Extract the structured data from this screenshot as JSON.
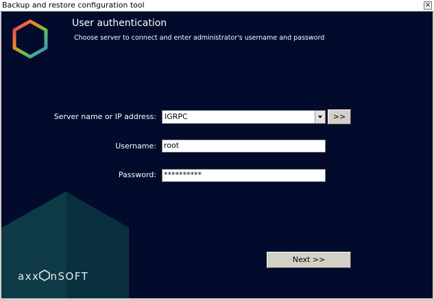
{
  "window": {
    "title": "Backup and restore configuration tool",
    "close_glyph": "×"
  },
  "header": {
    "title": "User authentication",
    "subtitle": "Choose server to connect and enter administrator's username and password"
  },
  "form": {
    "server_label": "Server name or IP address:",
    "server_value": "IGRPC",
    "browse_label": ">>",
    "username_label": "Username:",
    "username_value": "root",
    "password_label": "Password:",
    "password_value": "**********"
  },
  "footer": {
    "next_label": "Next >>",
    "brand_prefix": "axx",
    "brand_suffix": "nSOFT"
  },
  "colors": {
    "background": "#020b2c",
    "hex_panel": "#0f3a48"
  },
  "icons": {
    "logo": "hexagon-logo-icon",
    "dropdown": "chevron-down-icon",
    "close": "close-icon"
  }
}
